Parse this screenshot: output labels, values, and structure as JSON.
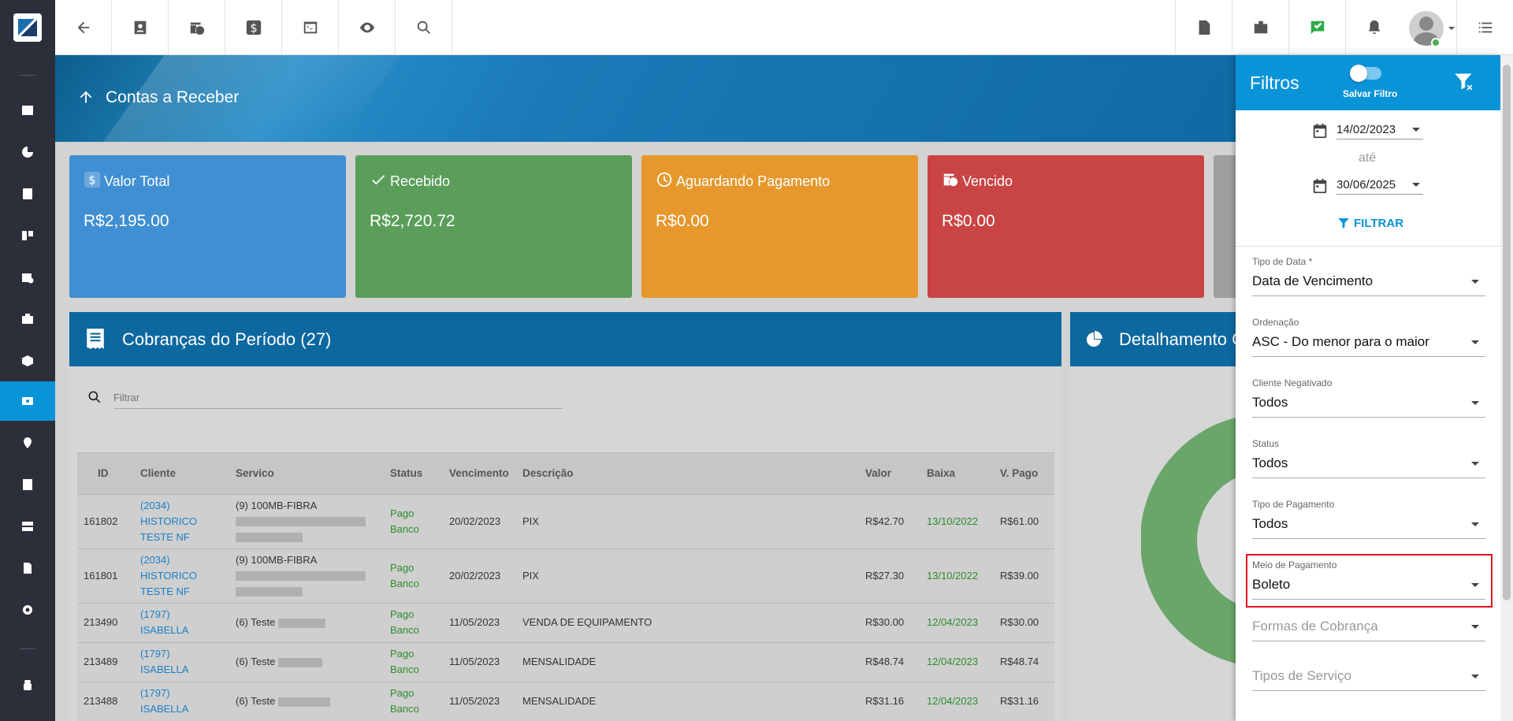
{
  "page": {
    "title": "Contas a Receber"
  },
  "cards": [
    {
      "label": "Valor Total",
      "value": "R$2,195.00",
      "color": "#3f8fd2",
      "icon": "dollar-icon"
    },
    {
      "label": "Recebido",
      "value": "R$2,720.72",
      "color": "#5a9e5a",
      "icon": "check-icon"
    },
    {
      "label": "Aguardando Pagamento",
      "value": "R$0.00",
      "color": "#e6982d",
      "icon": "clock-icon"
    },
    {
      "label": "Vencido",
      "value": "R$0.00",
      "color": "#c94444",
      "icon": "calendar-clock-icon"
    }
  ],
  "cobrancas": {
    "title": "Cobranças do Período (27)",
    "filter_placeholder": "Filtrar",
    "columns": [
      "ID",
      "Cliente",
      "Servico",
      "Status",
      "Vencimento",
      "Descrição",
      "Valor",
      "Baixa",
      "V. Pago"
    ],
    "rows": [
      {
        "id": "161802",
        "cliente_code": "(2034)",
        "cliente_name": "HISTORICO TESTE NF",
        "servico": "(9) 100MB-FIBRA",
        "status": "Pago Banco",
        "vencimento": "20/02/2023",
        "descricao": "PIX",
        "valor": "R$42.70",
        "baixa": "13/10/2022",
        "vpago": "R$61.00"
      },
      {
        "id": "161801",
        "cliente_code": "(2034)",
        "cliente_name": "HISTORICO TESTE NF",
        "servico": "(9) 100MB-FIBRA",
        "status": "Pago Banco",
        "vencimento": "20/02/2023",
        "descricao": "PIX",
        "valor": "R$27.30",
        "baixa": "13/10/2022",
        "vpago": "R$39.00"
      },
      {
        "id": "213490",
        "cliente_code": "(1797)",
        "cliente_name": "ISABELLA",
        "servico": "(6) Teste",
        "status": "Pago Banco",
        "vencimento": "11/05/2023",
        "descricao": "VENDA DE EQUIPAMENTO",
        "valor": "R$30.00",
        "baixa": "12/04/2023",
        "vpago": "R$30.00"
      },
      {
        "id": "213489",
        "cliente_code": "(1797)",
        "cliente_name": "ISABELLA",
        "servico": "(6) Teste",
        "status": "Pago Banco",
        "vencimento": "11/05/2023",
        "descricao": "MENSALIDADE",
        "valor": "R$48.74",
        "baixa": "12/04/2023",
        "vpago": "R$48.74"
      },
      {
        "id": "213488",
        "cliente_code": "(1797)",
        "cliente_name": "ISABELLA",
        "servico": "(6) Teste",
        "status": "Pago Banco",
        "vencimento": "11/05/2023",
        "descricao": "MENSALIDADE",
        "valor": "R$31.16",
        "baixa": "12/04/2023",
        "vpago": "R$31.16"
      }
    ]
  },
  "detalhamento": {
    "title": "Detalhamento C"
  },
  "filters": {
    "title": "Filtros",
    "salvar_label": "Salvar Filtro",
    "date_from": "14/02/2023",
    "date_sep": "até",
    "date_to": "30/06/2025",
    "filtrar_label": "FILTRAR",
    "fields": [
      {
        "label": "Tipo de Data *",
        "value": "Data de Vencimento"
      },
      {
        "label": "Ordenação",
        "value": "ASC - Do menor para o maior"
      },
      {
        "label": "Cliente Negativado",
        "value": "Todos"
      },
      {
        "label": "Status",
        "value": "Todos"
      },
      {
        "label": "Tipo de Pagamento",
        "value": "Todos"
      },
      {
        "label": "Meio de Pagamento",
        "value": "Boleto"
      }
    ],
    "placeholders": [
      "Formas de Cobrança",
      "Tipos de Serviço"
    ]
  },
  "colors": {
    "accent": "#0a94d8",
    "header": "#0d68a0",
    "sidebar": "#2c2f3a",
    "highlight": "#e0101e",
    "paid": "#2e8b2e",
    "link": "#1a7fc7"
  }
}
